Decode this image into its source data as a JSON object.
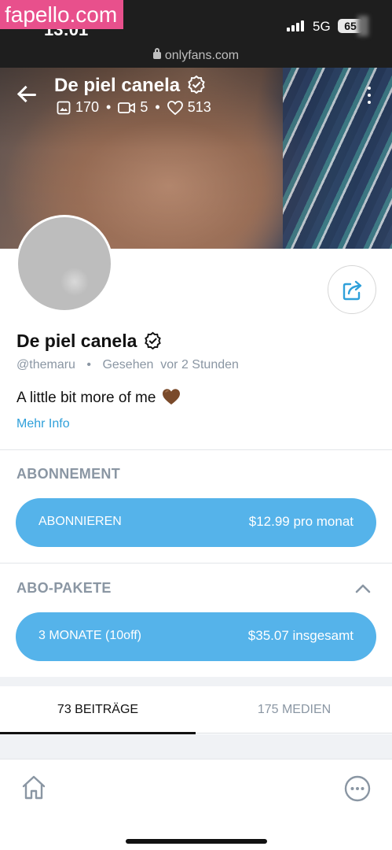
{
  "watermark": "fapello.com",
  "status_bar": {
    "time_visible": "13:01",
    "network": "5G",
    "battery": "65"
  },
  "browser": {
    "url": "onlyfans.com"
  },
  "cover": {
    "title": "De piel canela",
    "photos_count": "170",
    "videos_count": "5",
    "likes_count": "513"
  },
  "profile": {
    "name": "De piel canela",
    "handle": "@themaru",
    "separator": "•",
    "last_seen": "Gesehen  vor 2 Stunden",
    "bio": "A little bit more of me",
    "more_info": "Mehr Info"
  },
  "subscription": {
    "section_title": "ABONNEMENT",
    "button_label": "ABONNIEREN",
    "button_price": "$12.99 pro monat"
  },
  "bundles": {
    "section_title": "ABO-PAKETE",
    "items": [
      {
        "label": "3 MONATE (10off)",
        "price": "$35.07 insgesamt"
      }
    ]
  },
  "tabs": [
    {
      "label": "73 BEITRÄGE",
      "active": true
    },
    {
      "label": "175 MEDIEN",
      "active": false
    }
  ],
  "colors": {
    "accent": "#55b3ea",
    "link": "#2fa0da",
    "muted": "#8a96a3"
  },
  "icons": [
    "back-arrow-icon",
    "verified-icon",
    "image-icon",
    "video-icon",
    "heart-outline-icon",
    "kebab-menu-icon",
    "share-icon",
    "heart-emoji-icon",
    "chevron-up-icon",
    "home-icon",
    "more-options-icon"
  ]
}
